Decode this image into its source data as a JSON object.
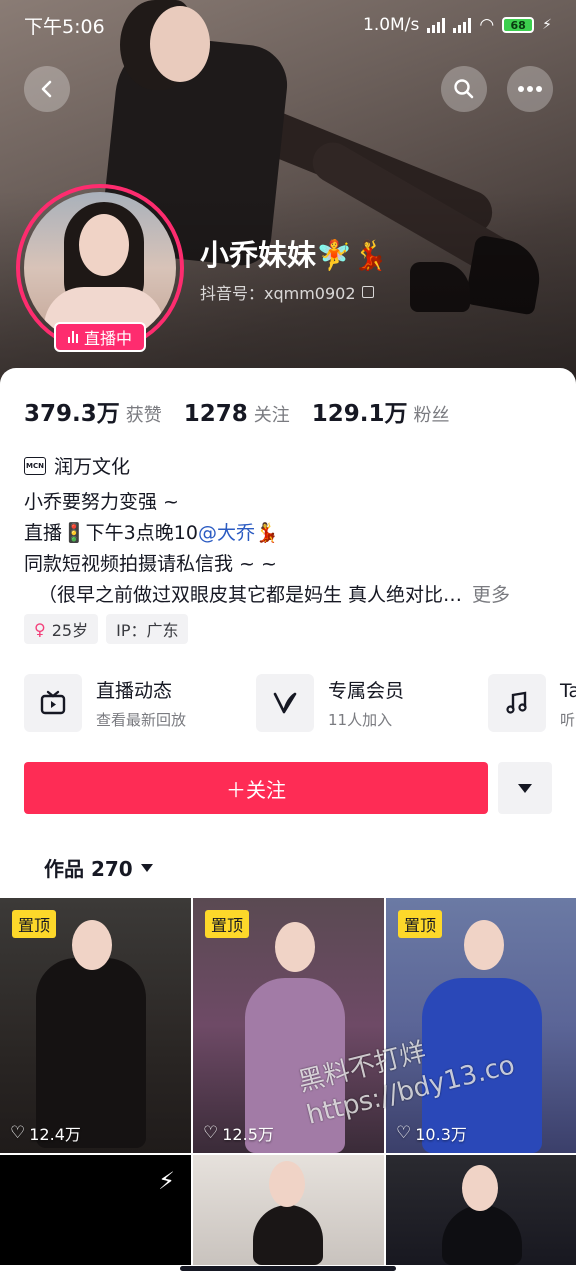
{
  "status_bar": {
    "time": "下午5:06",
    "net_speed": "1.0M/s",
    "battery": "68"
  },
  "profile": {
    "nickname": "小乔妹妹🧚💃",
    "douyin_id": "抖音号：xqmm0902",
    "live_badge": "直播中",
    "stats": [
      {
        "value": "379.3万",
        "label": "获赞"
      },
      {
        "value": "1278",
        "label": "关注"
      },
      {
        "value": "129.1万",
        "label": "粉丝"
      }
    ],
    "mcn": {
      "icon_text": "MCN",
      "name": "润万文化"
    },
    "bio": {
      "line1": "小乔要努力变强 ~",
      "line2_prefix": "直播🚦下午3点晚10",
      "line2_mention": "@大乔",
      "line2_suffix": "💃",
      "line3": "同款短视频拍摄请私信我 ~ ~",
      "line4": "（很早之前做过双眼皮其它都是妈生 真人绝对比…",
      "more": "更多"
    },
    "tags": {
      "age": "25岁",
      "ip": "IP：广东"
    }
  },
  "features": [
    {
      "icon": "tv-icon",
      "title": "直播动态",
      "subtitle": "查看最新回放"
    },
    {
      "icon": "v-icon",
      "title": "专属会员",
      "subtitle": "11人加入"
    },
    {
      "icon": "music-icon",
      "title": "Ta的音",
      "subtitle": "听听ta"
    }
  ],
  "actions": {
    "follow": "＋关注"
  },
  "works": {
    "label": "作品 270"
  },
  "grid": [
    {
      "pinned": "置顶",
      "likes": "12.4万"
    },
    {
      "pinned": "置顶",
      "likes": "12.5万"
    },
    {
      "pinned": "置顶",
      "likes": "10.3万"
    }
  ],
  "watermark": {
    "line1": "黑料不打烊",
    "line2": "https://bdy13.co"
  },
  "colors": {
    "accent": "#fe2c55",
    "live": "#fe2c6f",
    "pin": "#fdd82a",
    "mention": "#2b5bc2"
  }
}
